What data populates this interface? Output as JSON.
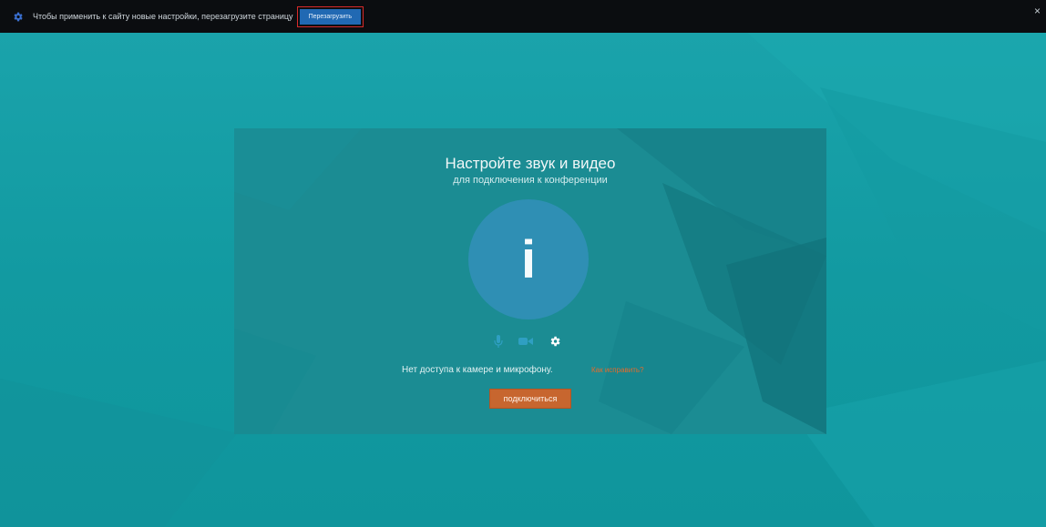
{
  "notification": {
    "message": "Чтобы применить к сайту новые настройки, перезагрузите страницу",
    "reload_label": "Перезагрузить",
    "close_glyph": "×",
    "icons": [
      "gear-icon",
      "close-icon"
    ]
  },
  "conference": {
    "title": "Настройте звук и видео",
    "subtitle": "для подключения к конференции",
    "avatar_letter": "i",
    "controls": [
      "microphone-icon",
      "camera-icon",
      "settings-icon"
    ],
    "status_text": "Нет доступа к камере и микрофону.",
    "fix_link": "Как исправить?",
    "connect_label": "подключиться"
  },
  "colors": {
    "background": "#16a1a8",
    "panel": "#1b8c93",
    "avatar": "#2f8fb4",
    "topbar": "#0b0d10",
    "reload_button": "#2169b3",
    "highlight_border": "#d72a2a",
    "connect_button": "#c7662f",
    "link": "#e46b2c"
  }
}
